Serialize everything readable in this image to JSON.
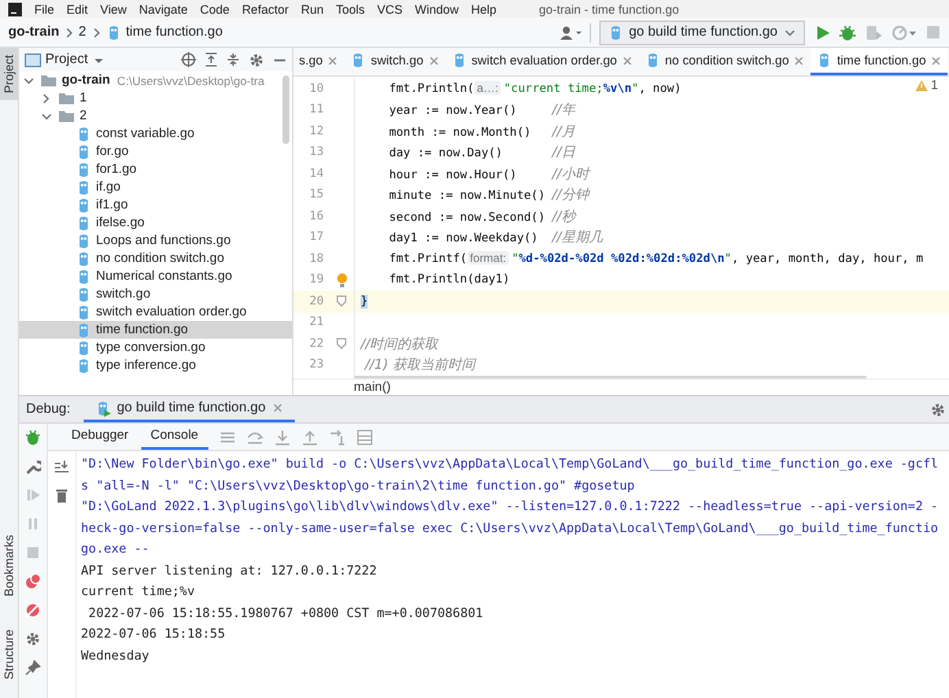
{
  "menu": [
    "File",
    "Edit",
    "View",
    "Navigate",
    "Code",
    "Refactor",
    "Run",
    "Tools",
    "VCS",
    "Window",
    "Help"
  ],
  "window": {
    "title": "go-train - time function.go"
  },
  "breadcrumb": [
    "go-train",
    "2",
    "time function.go"
  ],
  "run_config": {
    "label": "go build time function.go"
  },
  "side_tabs_top": [
    {
      "label": "Project",
      "selected": true
    }
  ],
  "side_tabs_bottom": [
    {
      "label": "Bookmarks",
      "selected": false
    },
    {
      "label": "Structure",
      "selected": false
    }
  ],
  "project": {
    "title": "Project",
    "tree": [
      {
        "label": "go-train",
        "path": "C:\\Users\\vvz\\Desktop\\go-tra",
        "kind": "folder",
        "expanded": true,
        "selected": false,
        "children": [
          {
            "label": "1",
            "kind": "folder",
            "expanded": false,
            "selected": false
          },
          {
            "label": "2",
            "kind": "folder",
            "expanded": true,
            "selected": false,
            "children": [
              {
                "label": "const variable.go",
                "kind": "file",
                "selected": false
              },
              {
                "label": "for.go",
                "kind": "file",
                "selected": false
              },
              {
                "label": "for1.go",
                "kind": "file",
                "selected": false
              },
              {
                "label": "if.go",
                "kind": "file",
                "selected": false
              },
              {
                "label": "if1.go",
                "kind": "file",
                "selected": false
              },
              {
                "label": "ifelse.go",
                "kind": "file",
                "selected": false
              },
              {
                "label": "Loops and functions.go",
                "kind": "file",
                "selected": false
              },
              {
                "label": "no condition switch.go",
                "kind": "file",
                "selected": false
              },
              {
                "label": "Numerical constants.go",
                "kind": "file",
                "selected": false
              },
              {
                "label": "switch.go",
                "kind": "file",
                "selected": false
              },
              {
                "label": "switch evaluation order.go",
                "kind": "file",
                "selected": false
              },
              {
                "label": "time function.go",
                "kind": "file",
                "selected": true
              },
              {
                "label": "type conversion.go",
                "kind": "file",
                "selected": false
              },
              {
                "label": "type inference.go",
                "kind": "file",
                "selected": false
              }
            ]
          }
        ]
      }
    ]
  },
  "editor": {
    "tabs": [
      {
        "label": "s.go",
        "selected": false
      },
      {
        "label": "switch.go",
        "selected": false
      },
      {
        "label": "switch evaluation order.go",
        "selected": false
      },
      {
        "label": "no condition switch.go",
        "selected": false
      },
      {
        "label": "time function.go",
        "selected": true
      }
    ],
    "warnings": "1",
    "lines": [
      {
        "number": "10",
        "current": false,
        "indented": true,
        "tokens": [
          {
            "kind": "plain",
            "text": "fmt.Println("
          },
          {
            "kind": "hint",
            "text": "a…:"
          },
          {
            "kind": "string",
            "text": "\"current time;"
          },
          {
            "kind": "format",
            "text": "%v\\n"
          },
          {
            "kind": "string",
            "text": "\""
          },
          {
            "kind": "plain",
            "text": ", now)"
          }
        ]
      },
      {
        "number": "11",
        "current": false,
        "indented": true,
        "tokens": [
          {
            "kind": "plain",
            "text": "year := now.Year()"
          },
          {
            "kind": "comment",
            "text": "//年"
          }
        ]
      },
      {
        "number": "12",
        "current": false,
        "indented": true,
        "tokens": [
          {
            "kind": "plain",
            "text": "month := now.Month()"
          },
          {
            "kind": "comment",
            "text": "//月"
          }
        ]
      },
      {
        "number": "13",
        "current": false,
        "indented": true,
        "tokens": [
          {
            "kind": "plain",
            "text": "day := now.Day()"
          },
          {
            "kind": "comment",
            "text": "//日"
          }
        ]
      },
      {
        "number": "14",
        "current": false,
        "indented": true,
        "tokens": [
          {
            "kind": "plain",
            "text": "hour := now.Hour()"
          },
          {
            "kind": "comment",
            "text": "//小时"
          }
        ]
      },
      {
        "number": "15",
        "current": false,
        "indented": true,
        "tokens": [
          {
            "kind": "plain",
            "text": "minute := now.Minute()"
          },
          {
            "kind": "comment",
            "text": "//分钟"
          }
        ]
      },
      {
        "number": "16",
        "current": false,
        "indented": true,
        "tokens": [
          {
            "kind": "plain",
            "text": "second := now.Second()"
          },
          {
            "kind": "comment",
            "text": "//秒"
          }
        ]
      },
      {
        "number": "17",
        "current": false,
        "indented": true,
        "tokens": [
          {
            "kind": "plain",
            "text": "day1 := now.Weekday()"
          },
          {
            "kind": "comment",
            "text": "//星期几"
          }
        ]
      },
      {
        "number": "18",
        "current": false,
        "indented": true,
        "tokens": [
          {
            "kind": "plain",
            "text": "fmt.Printf("
          },
          {
            "kind": "hint",
            "text": "format:"
          },
          {
            "kind": "string",
            "text": "\""
          },
          {
            "kind": "format",
            "text": "%d-%02d-%02d %02d:%02d:%02d\\n"
          },
          {
            "kind": "string",
            "text": "\""
          },
          {
            "kind": "plain",
            "text": ", year, month, day, hour, m"
          }
        ]
      },
      {
        "number": "19",
        "current": false,
        "indented": true,
        "kind": "bulb",
        "tokens": [
          {
            "kind": "plain",
            "text": "fmt.Println(day1)"
          }
        ]
      },
      {
        "number": "20",
        "current": true,
        "indented": false,
        "kind": "fold",
        "tokens": [
          {
            "kind": "brace",
            "text": "}"
          }
        ]
      },
      {
        "number": "21",
        "current": false,
        "kind": "plain"
      },
      {
        "number": "22",
        "current": false,
        "indented": false,
        "kind": "fold",
        "tokens": [
          {
            "kind": "comment",
            "text": "//时间的获取"
          }
        ]
      },
      {
        "number": "23",
        "current": false,
        "indented": false,
        "tokens": [
          {
            "kind": "comment",
            "text": " //1) 获取当前时间"
          }
        ]
      }
    ],
    "footer": "main()"
  },
  "debug": {
    "label": "Debug:",
    "session": {
      "label": "go build time function.go",
      "selected": true
    },
    "tabs": [
      {
        "label": "Debugger",
        "selected": false
      },
      {
        "label": "Console",
        "selected": true
      }
    ],
    "console": [
      {
        "kind": "command",
        "text": "\"D:\\New Folder\\bin\\go.exe\" build -o C:\\Users\\vvz\\AppData\\Local\\Temp\\GoLand\\___go_build_time_function_go.exe -gcfl"
      },
      {
        "kind": "command",
        "text": "s \"all=-N -l\" \"C:\\Users\\vvz\\Desktop\\go-train\\2\\time function.go\" #gosetup"
      },
      {
        "kind": "command",
        "text": "\"D:\\GoLand 2022.1.3\\plugins\\go\\lib\\dlv\\windows\\dlv.exe\" --listen=127.0.0.1:7222 --headless=true --api-version=2 -"
      },
      {
        "kind": "command",
        "text": "heck-go-version=false --only-same-user=false exec C:\\Users\\vvz\\AppData\\Local\\Temp\\GoLand\\___go_build_time_functio"
      },
      {
        "kind": "command",
        "text": "go.exe --"
      },
      {
        "kind": "output",
        "text": "API server listening at: 127.0.0.1:7222"
      },
      {
        "kind": "output",
        "text": "current time;%v"
      },
      {
        "kind": "output",
        "text": " 2022-07-06 15:18:55.1980767 +0800 CST m=+0.007086801"
      },
      {
        "kind": "output",
        "text": "2022-07-06 15:18:55"
      },
      {
        "kind": "output",
        "text": "Wednesday"
      }
    ]
  }
}
